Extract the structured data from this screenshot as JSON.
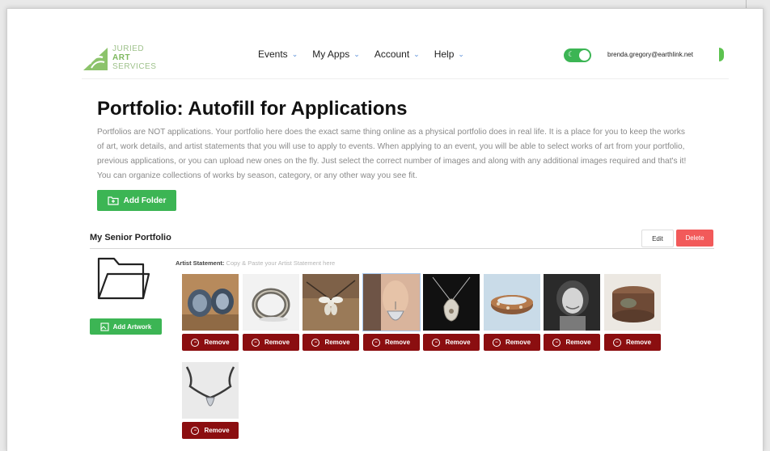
{
  "brand": {
    "line1": "JURIED",
    "line2": "ART",
    "line3": "SERVICES"
  },
  "nav": [
    {
      "label": "Events"
    },
    {
      "label": "My Apps"
    },
    {
      "label": "Account"
    },
    {
      "label": "Help"
    }
  ],
  "user": {
    "email": "brenda.gregory@earthlink.net"
  },
  "page": {
    "title": "Portfolio: Autofill for Applications",
    "intro": "Portfolios are NOT applications. Your portfolio here does the exact same thing online as a physical portfolio does in real life. It is a place for you to keep the works of art, work details, and artist statements that you will use to apply to events. When applying to an event, you will be able to select works of art from your portfolio, previous applications, or you can upload new ones on the fly. Just select the correct number of images and along with any additional images required and that's it! You can organize collections of works by season, category, or any other way you see fit.",
    "add_folder_label": "Add Folder"
  },
  "folder": {
    "title": "My Senior Portfolio",
    "edit_label": "Edit",
    "delete_label": "Delete",
    "add_artwork_label": "Add Artwork",
    "artist_statement_label": "Artist Statement:",
    "artist_statement_placeholder": "Copy & Paste your Artist Statement here",
    "remove_label": "Remove",
    "artworks": [
      {
        "name": "earrings-1"
      },
      {
        "name": "ring"
      },
      {
        "name": "flower-pendant"
      },
      {
        "name": "earring-model"
      },
      {
        "name": "teardrop-necklace"
      },
      {
        "name": "bangle"
      },
      {
        "name": "artist-portrait"
      },
      {
        "name": "copper-box"
      },
      {
        "name": "chain-necklace"
      }
    ]
  },
  "colors": {
    "green": "#3cb554",
    "remove_red": "#8b0e10",
    "delete_red": "#f25a5a",
    "nav_chevron": "#5a8fd8"
  }
}
